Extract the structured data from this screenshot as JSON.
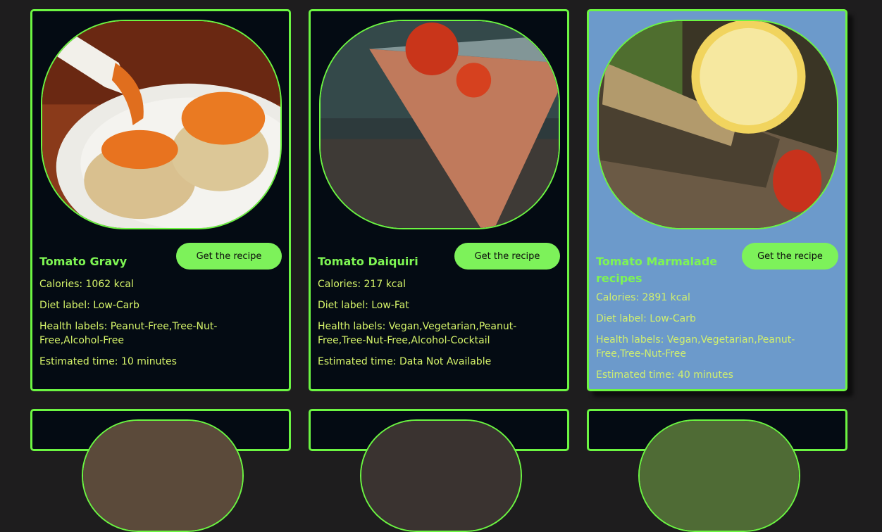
{
  "cards": [
    {
      "title": "Tomato Gravy",
      "button": "Get the recipe",
      "calories": "Calories: 1062 kcal",
      "diet": "Diet label: Low-Carb",
      "health": "Health labels: Peanut-Free,Tree-Nut-Free,Alcohol-Free",
      "time": "Estimated time: 10 minutes"
    },
    {
      "title": "Tomato Daiquiri",
      "button": "Get the recipe",
      "calories": "Calories: 217 kcal",
      "diet": "Diet label: Low-Fat",
      "health": "Health labels: Vegan,Vegetarian,Peanut-Free,Tree-Nut-Free,Alcohol-Cocktail",
      "time": "Estimated time: Data Not Available"
    },
    {
      "title": "Tomato Marmalade recipes",
      "button": "Get the recipe",
      "calories": "Calories: 2891 kcal",
      "diet": "Diet label: Low-Carb",
      "health": "Health labels: Vegan,Vegetarian,Peanut-Free,Tree-Nut-Free",
      "time": "Estimated time: 40 minutes"
    }
  ],
  "colors": {
    "page_bg": "#1e1d1e",
    "card_bg": "#040b13",
    "card_highlight_bg": "#6c9acb",
    "accent_green": "#6cf542",
    "button_bg": "#7df25a",
    "text": "#d6f46a"
  }
}
